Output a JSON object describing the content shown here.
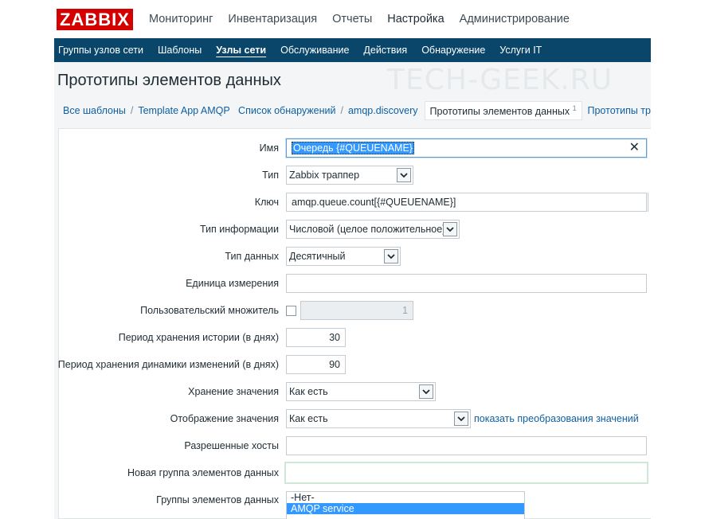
{
  "app": {
    "logo_text": "ZABBIX",
    "brand_color": "#d40000",
    "nav_color": "#0a466a",
    "link_color": "#0f5fa2"
  },
  "main_menu": [
    {
      "label": "Мониторинг",
      "active": false
    },
    {
      "label": "Инвентаризация",
      "active": false
    },
    {
      "label": "Отчеты",
      "active": false
    },
    {
      "label": "Настройка",
      "active": true
    },
    {
      "label": "Администрирование",
      "active": false
    }
  ],
  "sub_menu": [
    {
      "label": "Группы узлов сети",
      "active": false
    },
    {
      "label": "Шаблоны",
      "active": false
    },
    {
      "label": "Узлы сети",
      "active": true
    },
    {
      "label": "Обслуживание",
      "active": false
    },
    {
      "label": "Действия",
      "active": false
    },
    {
      "label": "Обнаружение",
      "active": false
    },
    {
      "label": "Услуги IT",
      "active": false
    }
  ],
  "page": {
    "title": "Прототипы элементов данных",
    "watermark": "TECH-GEEK.RU"
  },
  "breadcrumbs": {
    "all_templates": "Все шаблоны",
    "template": "Template App AMQP",
    "discovery_list": "Список обнаружений",
    "discovery": "amqp.discovery",
    "item_prototypes": "Прототипы элементов данных",
    "item_prototypes_count": "1",
    "trigger_prototypes": "Прототипы тр",
    "separator": "/"
  },
  "form": {
    "name": {
      "label": "Имя",
      "value": "Очередь {#QUEUENAME}",
      "clear_icon": "close-icon",
      "clear_glyph": "✕"
    },
    "type": {
      "label": "Тип",
      "value": "Zabbix траппер"
    },
    "key": {
      "label": "Ключ",
      "value": "amqp.queue.count[{#QUEUENAME}]"
    },
    "info_type": {
      "label": "Тип информации",
      "value": "Числовой (целое положительное)"
    },
    "data_type": {
      "label": "Тип данных",
      "value": "Десятичный"
    },
    "units": {
      "label": "Единица измерения",
      "value": ""
    },
    "multiplier": {
      "label": "Пользовательский множитель",
      "checked": false,
      "value": "1"
    },
    "history": {
      "label": "Период хранения истории (в днях)",
      "value": "30"
    },
    "trends": {
      "label": "Период хранения динамики изменений (в днях)",
      "value": "90"
    },
    "store_value": {
      "label": "Хранение значения",
      "value": "Как есть"
    },
    "show_value": {
      "label": "Отображение значения",
      "value": "Как есть",
      "link": "показать преобразования значений"
    },
    "allowed_hosts": {
      "label": "Разрешенные хосты",
      "value": ""
    },
    "new_application": {
      "label": "Новая группа элементов данных",
      "value": ""
    },
    "applications": {
      "label": "Группы элементов данных",
      "options": [
        "-Нет-",
        "AMQP service"
      ],
      "selected": "AMQP service"
    }
  }
}
